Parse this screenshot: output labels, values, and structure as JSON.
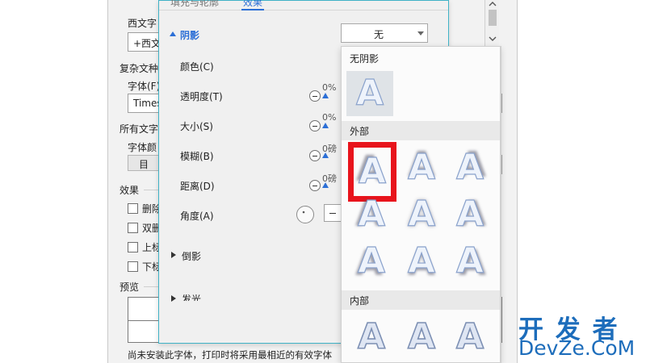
{
  "font_dialog": {
    "western_font_label": "西文字",
    "western_font_value": "+西文",
    "complex_section_label": "复杂文种",
    "font_label": "字体(F)",
    "font_value": "Times",
    "all_text_label": "所有文字",
    "font_color_label": "字体颜",
    "font_color_button": "目",
    "effects_label": "效果",
    "effects": [
      "删除",
      "双删",
      "上标",
      "下标"
    ],
    "preview_label": "预览",
    "footer_note": "尚未安装此字体，打印时将采用最相近的有效字体"
  },
  "effects_panel": {
    "tabs": [
      "填充与轮廓",
      "效果"
    ],
    "shadow_section": "阴影",
    "shadow_value": "无",
    "rows": [
      {
        "label": "颜色(C)"
      },
      {
        "label": "透明度(T)",
        "value": "0%"
      },
      {
        "label": "大小(S)",
        "value": "0%"
      },
      {
        "label": "模糊(B)",
        "value": "0磅"
      },
      {
        "label": "距离(D)",
        "value": "0磅"
      },
      {
        "label": "角度(A)"
      }
    ],
    "reflection_section": "倒影",
    "glow_section": "发光"
  },
  "gallery": {
    "no_shadow_header": "无阴影",
    "outer_header": "外部",
    "inner_header": "内部",
    "tile_glyph": "A"
  },
  "watermark": {
    "line1": "开 发 者",
    "line2": "DevZe.CoM"
  },
  "colors": {
    "accent": "#2c6fd6",
    "selection_frame": "#e8141c",
    "panel_border": "#3fb2c6",
    "watermark": "#1d6dbb"
  }
}
